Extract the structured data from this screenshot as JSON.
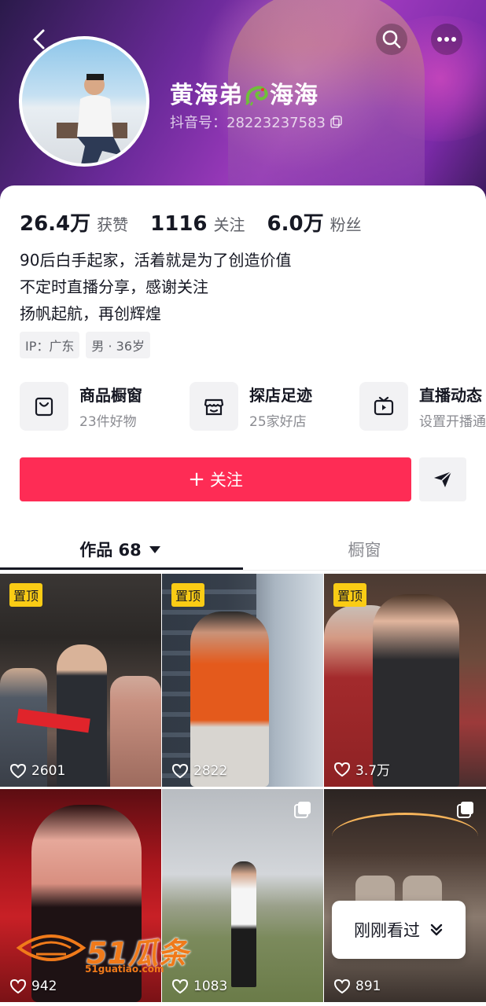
{
  "profile": {
    "name": "黄海弟",
    "name_suffix": "海海",
    "douyin_id": "抖音号：28223237583"
  },
  "stats": [
    {
      "value": "26.4万",
      "label": "获赞"
    },
    {
      "value": "1116",
      "label": "关注"
    },
    {
      "value": "6.0万",
      "label": "粉丝"
    }
  ],
  "bio": {
    "line1": "90后白手起家，活着就是为了创造价值",
    "line2": "不定时直播分享，感谢关注",
    "line3": "扬帆起航，再创辉煌"
  },
  "tags": {
    "ip": "IP：广东",
    "gender_age": "男 · 36岁"
  },
  "shortcuts": [
    {
      "title": "商品橱窗",
      "sub": "23件好物",
      "icon": "shopping-bag-icon"
    },
    {
      "title": "探店足迹",
      "sub": "25家好店",
      "icon": "store-icon"
    },
    {
      "title": "直播动态",
      "sub": "设置开播通",
      "icon": "live-tv-icon"
    }
  ],
  "actions": {
    "follow_plus": "+",
    "follow_label": "关注",
    "message_icon": "send-icon"
  },
  "tabs": {
    "works": "作品 68",
    "window": "橱窗"
  },
  "videos": [
    {
      "pinned": "置顶",
      "likes": "2601"
    },
    {
      "pinned": "置顶",
      "likes": "2822"
    },
    {
      "pinned": "置顶",
      "likes": "3.7万"
    },
    {
      "pinned": "",
      "likes": "942"
    },
    {
      "pinned": "",
      "likes": "1083"
    },
    {
      "pinned": "",
      "likes": "891"
    }
  ],
  "recent": {
    "label": "刚刚看过"
  },
  "watermark": {
    "text": "51瓜条",
    "sub": "51guatiao.com"
  },
  "colors": {
    "accent": "#fe2c55",
    "pin_badge": "#facc15"
  }
}
